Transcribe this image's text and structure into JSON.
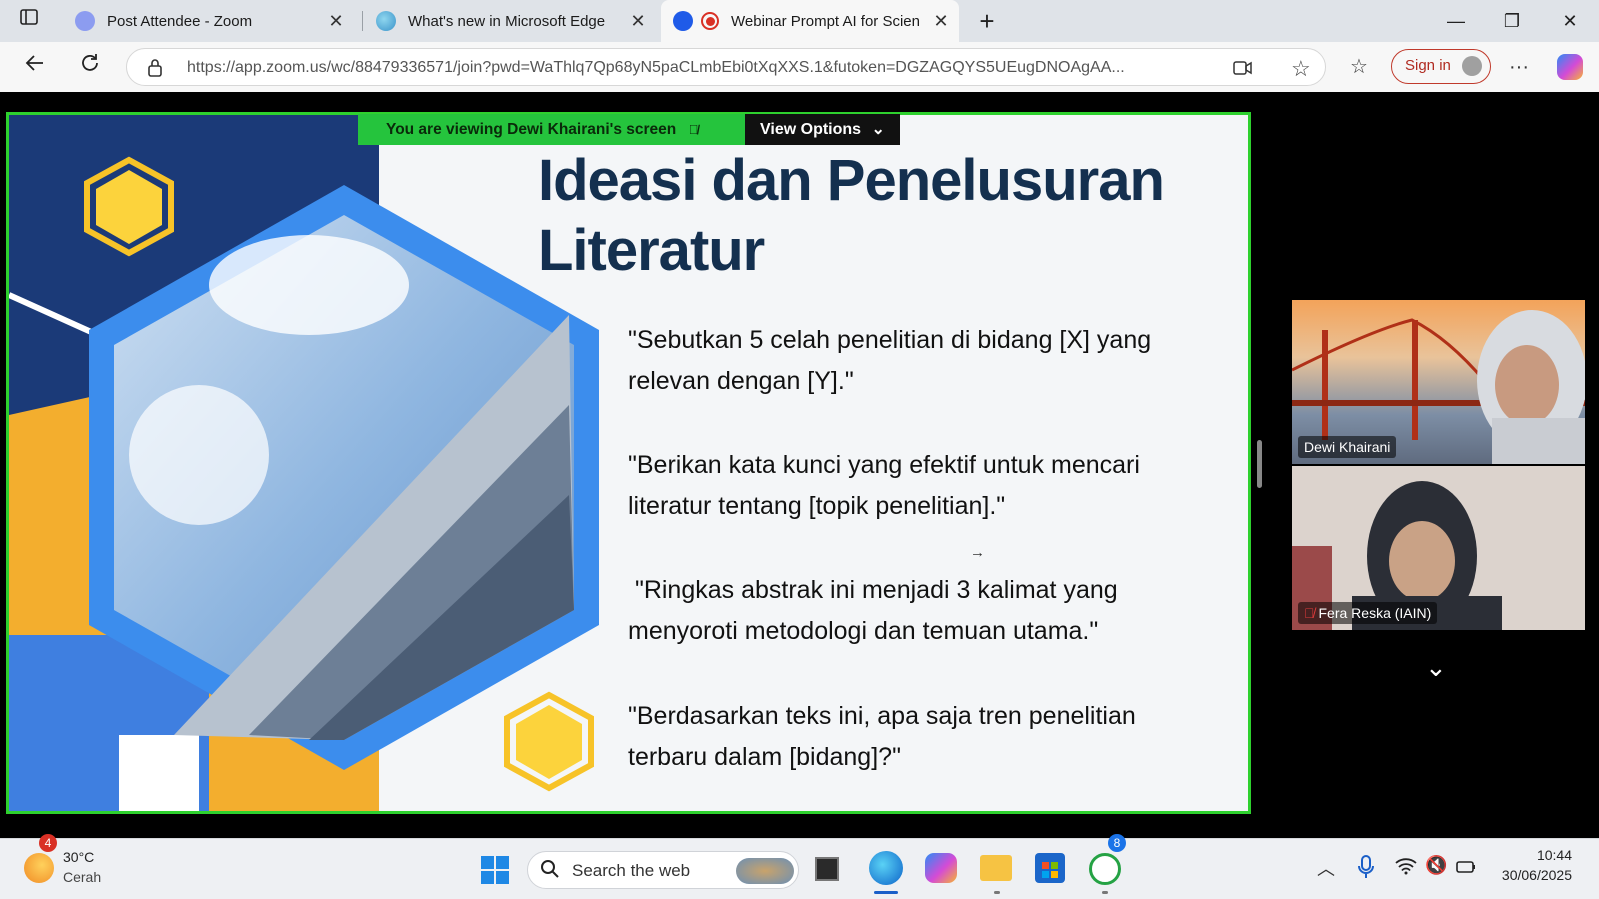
{
  "browser": {
    "tabs": [
      {
        "title": "Post Attendee - Zoom",
        "favicon": "zoom-icon",
        "active": false
      },
      {
        "title": "What's new in Microsoft Edge",
        "favicon": "edge-icon",
        "active": false
      },
      {
        "title": "Webinar Prompt AI for Scien",
        "favicon": "zoom-icon",
        "active": true,
        "recording": true
      }
    ],
    "new_tab": "+",
    "url": "https://app.zoom.us/wc/88479336571/join?pwd=WaThlq7Qp68yN5paCLmbEbi0tXqXXS.1&futoken=DGZAGQYS5UEugDNOAgAA...",
    "sign_in": "Sign in",
    "accent_color": "#2ed12e"
  },
  "zoom": {
    "viewing_banner": "You are viewing  Dewi Khairani's screen",
    "view_options": "View Options",
    "participants": [
      {
        "name": "Dewi Khairani",
        "muted": false
      },
      {
        "name": "Fera Reska (IAIN)",
        "muted": true
      }
    ]
  },
  "slide": {
    "title_line1": "Ideasi dan Penelusuran",
    "title_line2": "Literatur",
    "quotes": [
      {
        "line1": "\"Sebutkan 5 celah penelitian di bidang [X] yang",
        "line2": "relevan dengan [Y].\""
      },
      {
        "line1": "\"Berikan kata kunci yang efektif untuk mencari",
        "line2": "literatur tentang [topik penelitian].\""
      },
      {
        "line1": " \"Ringkas abstrak ini menjadi 3 kalimat yang",
        "line2": "menyoroti metodologi dan temuan utama.\""
      },
      {
        "line1": "\"Berdasarkan teks ini, apa saja tren penelitian",
        "line2": "terbaru dalam [bidang]?\""
      }
    ]
  },
  "taskbar": {
    "weather_temp": "30°C",
    "weather_desc": "Cerah",
    "weather_badge": "4",
    "search_placeholder": "Search the web",
    "whatsapp_badge": "8",
    "time": "10:44",
    "date": "30/06/2025"
  }
}
